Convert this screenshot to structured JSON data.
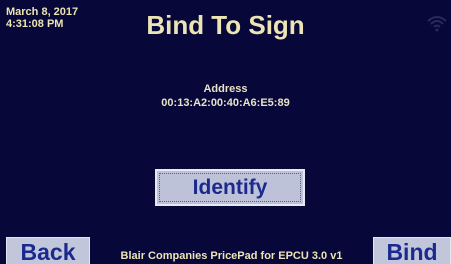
{
  "status": {
    "date": "March 8, 2017",
    "time": "4:31:08 PM",
    "wifi_icon": "wifi-icon"
  },
  "header": {
    "title": "Bind To Sign"
  },
  "address": {
    "label": "Address",
    "value": "00:13:A2:00:40:A6:E5:89"
  },
  "buttons": {
    "identify": "Identify",
    "back": "Back",
    "bind": "Bind"
  },
  "footer": {
    "text": "Blair Companies PricePad for EPCU 3.0 v1"
  },
  "colors": {
    "background": "#07073a",
    "title_text": "#ece4b4",
    "button_face": "#c2c6da",
    "button_text": "#1c2a8e"
  }
}
